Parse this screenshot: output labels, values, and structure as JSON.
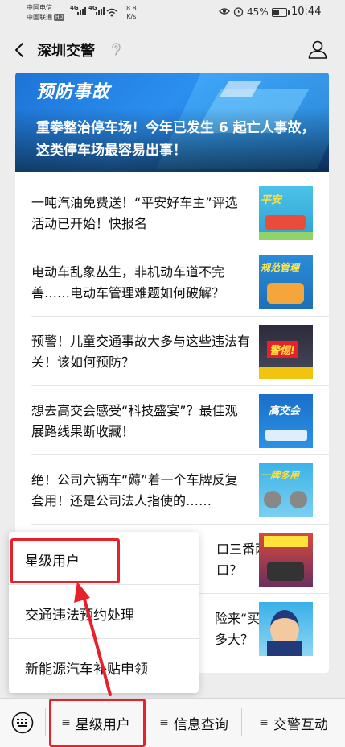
{
  "status": {
    "carrier1": "中国电信",
    "carrier2": "中国联通",
    "carrier2_badge": "HD",
    "net1": "4G",
    "net2": "4G",
    "speed_value": "8.8",
    "speed_unit": "K/s",
    "battery": "45%",
    "battery_level": 0.45,
    "time": "10:44"
  },
  "nav": {
    "title": "深圳交警"
  },
  "banner": {
    "headline": "预防事故",
    "title": "重拳整治停车场！今年已发生 6 起亡人事故，这类停车场最容易出事！"
  },
  "articles": [
    {
      "title": "一吨汽油免费送！“平安好车主”评选活动已开始！快报名",
      "thumb_text": "平安"
    },
    {
      "title": "电动车乱象丛生，非机动车道不完善……电动车管理难题如何破解？",
      "thumb_text": "规范管理"
    },
    {
      "title": "预警！儿童交通事故大多与这些违法有关！该如何预防？",
      "thumb_text": "警惕!"
    },
    {
      "title": "想去高交会感受“科技盛宴”？最佳观展路线果断收藏！",
      "thumb_text": "高交会"
    },
    {
      "title": "绝！公司六辆车“薅”着一个车牌反复套用！还是公司法人指使的……",
      "thumb_text": "一牌多用"
    },
    {
      "title": "ロ三番两\n　　　　　　　　　　　　　　　　　　　　　　　ロ？",
      "thumb_text": ""
    },
    {
      "title": "",
      "thumb_text": ""
    }
  ],
  "partial_article_6": {
    "line1": "口三番两",
    "line2": "口？"
  },
  "partial_article_7": {
    "line1": "险来“买",
    "line2": "多大？"
  },
  "popup": {
    "items": [
      "星级用户",
      "交通违法预约处理",
      "新能源汽车补贴申领"
    ]
  },
  "menu": {
    "items": [
      "星级用户",
      "信息查询",
      "交警互动"
    ]
  },
  "colors": {
    "highlight": "#e8202a",
    "banner_blue": "#2b8ff0"
  }
}
